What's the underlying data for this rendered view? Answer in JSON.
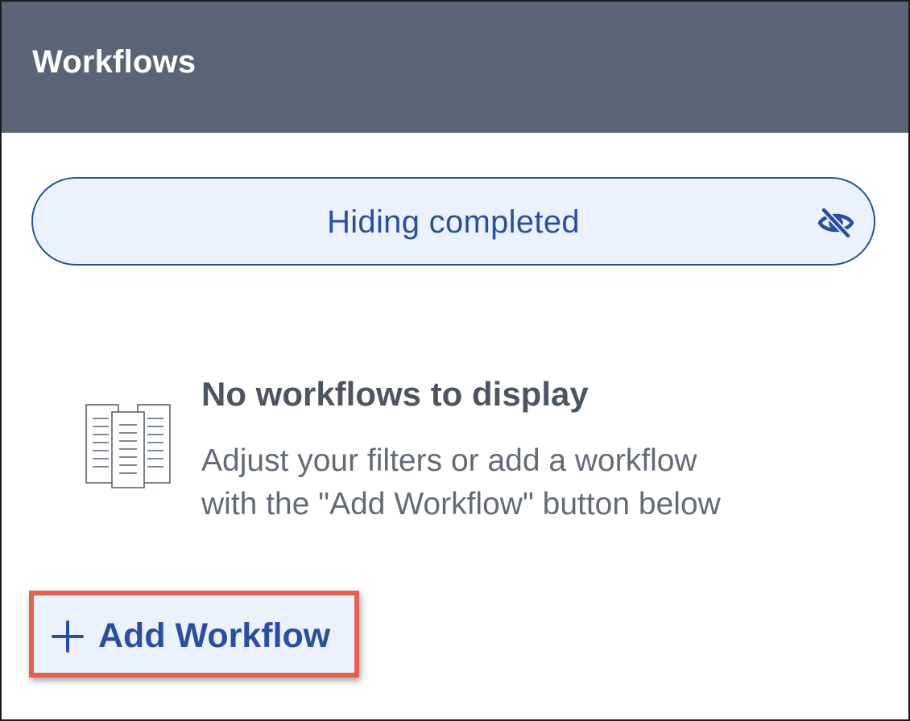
{
  "header": {
    "title": "Workflows"
  },
  "filter": {
    "label": "Hiding completed",
    "icon": "eye-off-icon"
  },
  "empty_state": {
    "icon": "documents-icon",
    "title": "No workflows to display",
    "description_line1": "Adjust your filters or add a workflow",
    "description_line2": "with the \"Add Workflow\" button below"
  },
  "actions": {
    "add_workflow_label": "Add Workflow",
    "add_icon": "plus-icon"
  },
  "colors": {
    "header_bg": "#596576",
    "accent": "#2a4ea0",
    "pill_bg": "#ebf2fd",
    "highlight": "#e5604f"
  }
}
